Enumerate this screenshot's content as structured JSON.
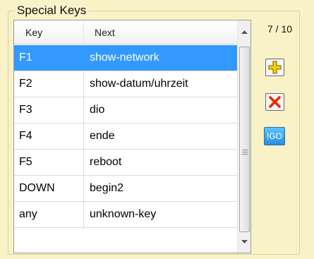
{
  "groupbox": {
    "title": "Special Keys"
  },
  "grid": {
    "columns": [
      "Key",
      "Next"
    ],
    "rows": [
      {
        "key": "F1",
        "next": "show-network",
        "selected": true
      },
      {
        "key": "F2",
        "next": "show-datum/uhrzeit"
      },
      {
        "key": "F3",
        "next": "dio"
      },
      {
        "key": "F4",
        "next": "ende"
      },
      {
        "key": "F5",
        "next": "reboot"
      },
      {
        "key": "DOWN",
        "next": "begin2"
      },
      {
        "key": "any",
        "next": "unknown-key"
      }
    ]
  },
  "counter": "7 / 10",
  "buttons": {
    "go_label": "!GO"
  },
  "colors": {
    "panel_bg": "#f9f2c6",
    "selection": "#3399ff",
    "delete_icon": "#e62800",
    "add_icon": "#f5d000"
  },
  "icons": {
    "add": "plus-icon",
    "delete": "delete-x-icon",
    "scroll_up": "scroll-up-arrow-icon",
    "scroll_down": "scroll-down-arrow-icon"
  }
}
